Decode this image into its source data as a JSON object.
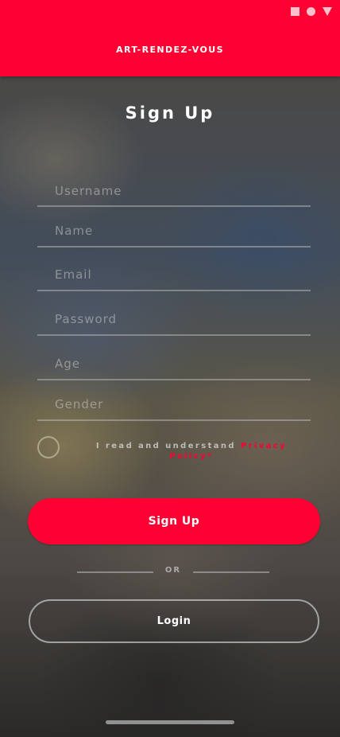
{
  "app_bar": {
    "title": "ART-RENDEZ-VOUS"
  },
  "status_bar": {
    "icons": [
      "square-icon",
      "circle-icon",
      "triangle-icon"
    ]
  },
  "page": {
    "title": "Sign Up"
  },
  "form": {
    "username_placeholder": "Username",
    "name_placeholder": "Name",
    "email_placeholder": "Email",
    "password_placeholder": "Password",
    "age_placeholder": "Age",
    "gender_placeholder": "Gender"
  },
  "consent": {
    "text": "I read and understand ",
    "link": "Privacy Policy*",
    "checked": false
  },
  "buttons": {
    "signup": "Sign Up",
    "or": "OR",
    "login": "Login"
  },
  "colors": {
    "accent": "#ff0033",
    "text": "#ffffff"
  }
}
